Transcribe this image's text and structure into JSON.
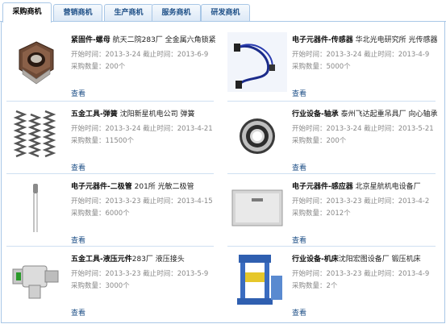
{
  "tabs": [
    "采购商机",
    "营销商机",
    "生产商机",
    "服务商机",
    "研发商机"
  ],
  "view_label": "查看",
  "items": [
    {
      "category": "紧固件-螺母",
      "rest": " 航天二院283厂 全金属六角锁紧",
      "line1": "开始时间：2013-3-24 截止时间：2013-6-9",
      "line2": "采购数量：200个",
      "image": "hex-nut-icon"
    },
    {
      "category": "电子元器件-传感器",
      "rest": " 华北光电研究所 光传感器",
      "line1": "开始时间：2013-3-24 截止时间：2013-4-9",
      "line2": "采购数量：5000个",
      "image": "optical-sensor-icon"
    },
    {
      "category": "五金工具-弹簧",
      "rest": " 沈阳新星机电公司 弹簧",
      "line1": "开始时间：2013-3-24 截止时间：2013-4-21",
      "line2": "采购数量：11500个",
      "image": "springs-icon"
    },
    {
      "category": "行业设备-轴承",
      "rest": " 泰州飞达起重吊具厂 向心轴承",
      "line1": "开始时间：2013-3-24 截止时间：2013-5-21",
      "line2": "采购数量：200个",
      "image": "bearing-icon"
    },
    {
      "category": "电子元器件-二极管",
      "rest": " 201所 光敏二极管",
      "line1": "开始时间：2013-3-23 截止时间：2013-4-15",
      "line2": "采购数量：6000个",
      "image": "diode-icon"
    },
    {
      "category": "电子元器件-感应器",
      "rest": " 北京星航机电设备厂",
      "line1": "开始时间：2013-3-23 截止时间：2013-4-2",
      "line2": "采购数量：2012个",
      "image": "induction-sensor-icon"
    },
    {
      "category": "五金工具-液压元件",
      "rest": "283厂 液压接头",
      "line1": "开始时间：2013-3-23 截止时间：2013-5-9",
      "line2": "采购数量：3000个",
      "image": "hydraulic-fitting-icon"
    },
    {
      "category": "行业设备-机床",
      "rest": "沈阳宏图设备厂 锻压机床",
      "line1": "开始时间：2013-3-23 截止时间：2013-4-9",
      "line2": "采购数量：2个",
      "image": "press-machine-icon"
    }
  ]
}
